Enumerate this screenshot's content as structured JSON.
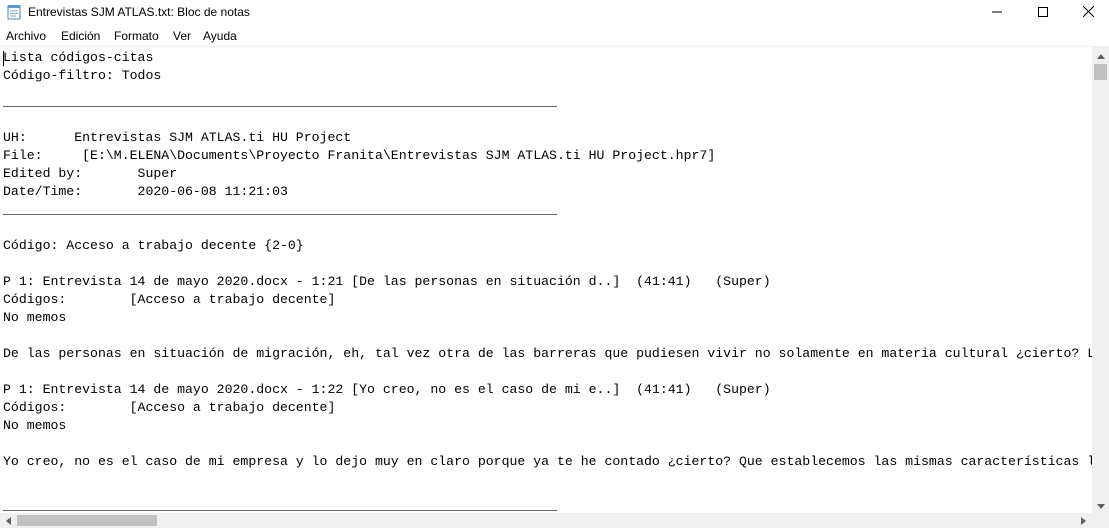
{
  "window": {
    "title": "Entrevistas SJM ATLAS.txt: Bloc de notas",
    "app_icon": "notepad-icon"
  },
  "menu": {
    "items": [
      "Archivo",
      "Edición",
      "Formato",
      "Ver",
      "Ayuda"
    ]
  },
  "document": {
    "lines": [
      "Lista códigos-citas",
      "Código-filtro: Todos",
      "",
      "______________________________________________________________________",
      "",
      "UH:      Entrevistas SJM ATLAS.ti HU Project",
      "File:     [E:\\M.ELENA\\Documents\\Proyecto Franita\\Entrevistas SJM ATLAS.ti HU Project.hpr7]",
      "Edited by:       Super",
      "Date/Time:       2020-06-08 11:21:03",
      "______________________________________________________________________",
      "",
      "Código: Acceso a trabajo decente {2-0}",
      "",
      "P 1: Entrevista 14 de mayo 2020.docx - 1:21 [De las personas en situación d..]  (41:41)   (Super)",
      "Códigos:        [Acceso a trabajo decente]",
      "No memos",
      "",
      "De las personas en situación de migración, eh, tal vez otra de las barreras que pudiesen vivir no solamente en materia cultural ¿cierto? Lo q",
      "",
      "P 1: Entrevista 14 de mayo 2020.docx - 1:22 [Yo creo, no es el caso de mi e..]  (41:41)   (Super)",
      "Códigos:        [Acceso a trabajo decente]",
      "No memos",
      "",
      "Yo creo, no es el caso de mi empresa y lo dejo muy en claro porque ya te he contado ¿cierto? Que establecemos las mismas características la",
      "",
      "",
      "______________________________________________________________________"
    ]
  },
  "icons": {
    "minimize": "minimize-icon",
    "maximize": "maximize-icon",
    "close": "close-icon"
  }
}
